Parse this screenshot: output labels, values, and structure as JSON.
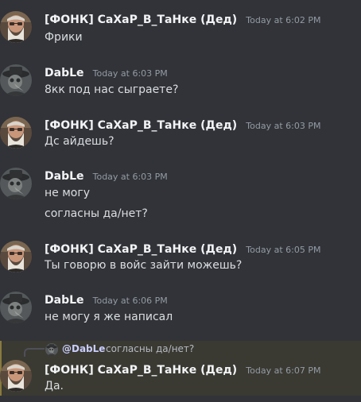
{
  "messages": [
    {
      "author": "[ФОНК] СаХаР_В_ТаНке (Дед)",
      "timestamp": "Today at 6:02 PM",
      "lines": [
        "Фрики"
      ],
      "avatar_icon": "bearded-man-avatar"
    },
    {
      "author": "DabLe",
      "timestamp": "Today at 6:03 PM",
      "lines": [
        "8кк под нас сыграете?"
      ],
      "avatar_icon": "plague-doctor-avatar"
    },
    {
      "author": "[ФОНК] СаХаР_В_ТаНке (Дед)",
      "timestamp": "Today at 6:03 PM",
      "lines": [
        "Дс айдешь?"
      ],
      "avatar_icon": "bearded-man-avatar"
    },
    {
      "author": "DabLe",
      "timestamp": "Today at 6:03 PM",
      "lines": [
        "не могу",
        "согласны да/нет?"
      ],
      "avatar_icon": "plague-doctor-avatar"
    },
    {
      "author": "[ФОНК] СаХаР_В_ТаНке (Дед)",
      "timestamp": "Today at 6:05 PM",
      "lines": [
        "Ты говорю в войс зайти можешь?"
      ],
      "avatar_icon": "bearded-man-avatar"
    },
    {
      "author": "DabLe",
      "timestamp": "Today at 6:06 PM",
      "lines": [
        "не могу я же написал"
      ],
      "avatar_icon": "plague-doctor-avatar"
    },
    {
      "author": "[ФОНК] СаХаР_В_ТаНке (Дед)",
      "timestamp": "Today at 6:07 PM",
      "lines": [
        "Да."
      ],
      "avatar_icon": "bearded-man-avatar",
      "reply": {
        "mention": "@DabLe",
        "text": "согласны да/нет?"
      }
    }
  ],
  "colors": {
    "background": "#313338",
    "username": "#f2f3f5",
    "timestamp": "#949ba4",
    "message_text": "#dbdee1",
    "mention_highlight_bg": "#3a3a33",
    "mention_bar": "#8a7a40",
    "mention_text": "#c9cdfb"
  }
}
